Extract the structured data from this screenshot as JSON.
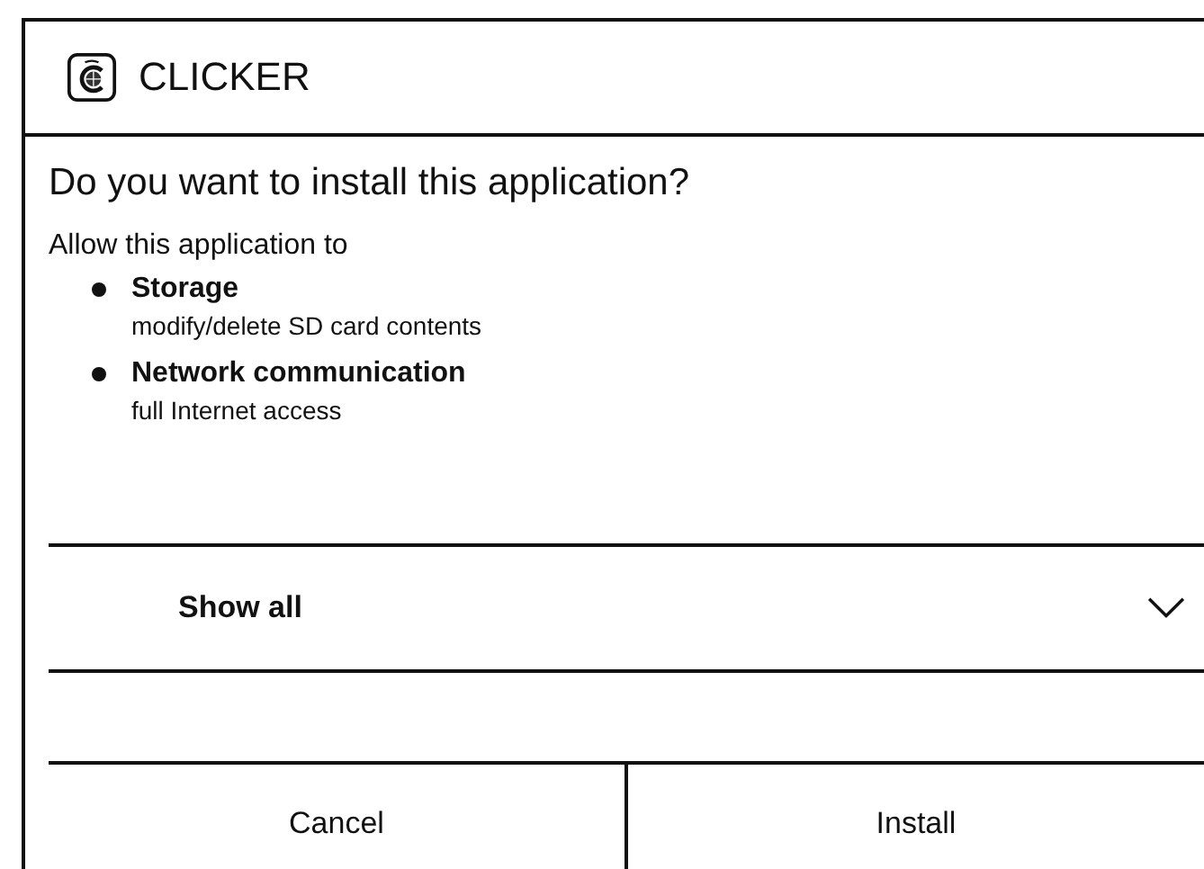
{
  "app": {
    "name": "CLICKER"
  },
  "prompt": "Do you want to install this application?",
  "permissions_intro": "Allow this application to",
  "permissions": [
    {
      "title": "Storage",
      "description": "modify/delete SD card contents"
    },
    {
      "title": "Network communication",
      "description": "full Internet access"
    }
  ],
  "show_all": {
    "label": "Show all",
    "expanded": false
  },
  "buttons": [
    {
      "label": "Cancel"
    },
    {
      "label": "Install"
    }
  ]
}
